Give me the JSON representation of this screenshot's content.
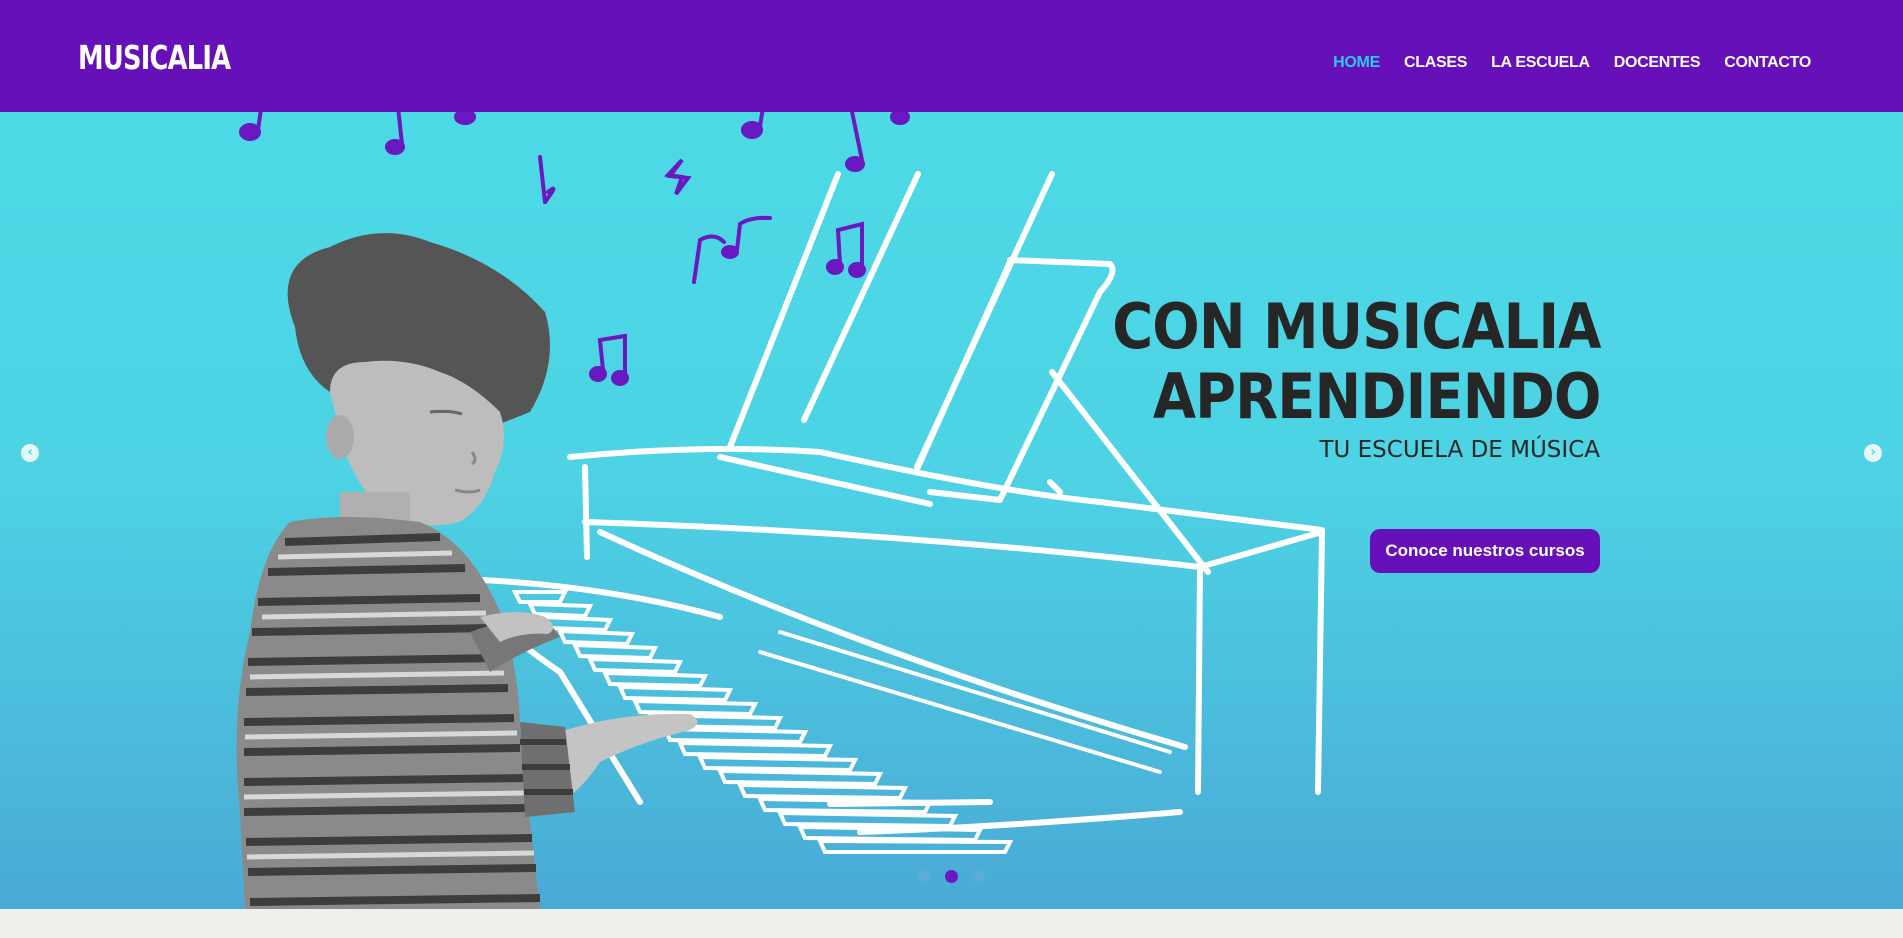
{
  "brand": {
    "logo": "MUSICALIA"
  },
  "nav": {
    "items": [
      {
        "label": "HOME",
        "active": true
      },
      {
        "label": "CLASES",
        "active": false
      },
      {
        "label": "LA ESCUELA",
        "active": false
      },
      {
        "label": "DOCENTES",
        "active": false
      },
      {
        "label": "CONTACTO",
        "active": false
      }
    ]
  },
  "hero": {
    "headline_line1": "CON MUSICALIA",
    "headline_line2": "APRENDIENDO",
    "subheading": "TU ESCUELA DE MÚSICA",
    "cta_label": "Conoce nuestros cursos",
    "image_description_icons": "boy-at-piano-illustration"
  },
  "slider": {
    "prev_icon": "chevron-left-icon",
    "next_icon": "chevron-right-icon",
    "prev_glyph": "‹",
    "next_glyph": "›",
    "dot_count": 3,
    "active_dot": 2
  },
  "colors": {
    "brand_purple": "#6610ba",
    "nav_active": "#2ec8ee",
    "hero_top": "#4dd9e6",
    "hero_bottom": "#4aaad6",
    "headline": "#262626",
    "footer_strip": "#efefeb"
  }
}
